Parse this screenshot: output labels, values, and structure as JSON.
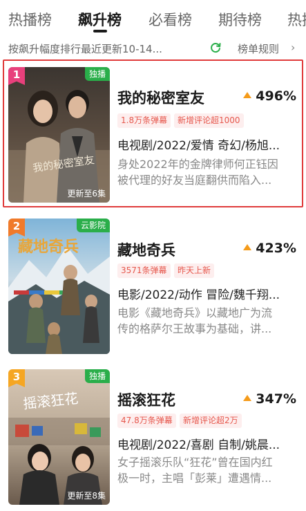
{
  "tabs": [
    {
      "label": "热播榜"
    },
    {
      "label": "飙升榜"
    },
    {
      "label": "必看榜"
    },
    {
      "label": "期待榜"
    },
    {
      "label": "热搜"
    }
  ],
  "subbar": {
    "desc": "按飙升幅度排行最近更新10-14...",
    "rules": "榜单规则",
    "chevron": "›"
  },
  "items": [
    {
      "rank": "1",
      "rank_color": "#e8407c",
      "badge": "独播",
      "episodes": "更新至6集",
      "title": "我的秘密室友",
      "growth": "496%",
      "tags": [
        "1.8万条弹幕",
        "新增评论超1000"
      ],
      "meta": "电视剧/2022/爱情 奇幻/杨旭...",
      "synopsis": [
        "身处2022年的金牌律师何正钰因",
        "被代理的好友当庭翻供而陷入..."
      ],
      "poster_art": "我的秘密室友"
    },
    {
      "rank": "2",
      "rank_color": "#f07a2a",
      "badge": "云影院",
      "episodes": "",
      "title": "藏地奇兵",
      "growth": "423%",
      "tags": [
        "3571条弹幕",
        "昨天上新"
      ],
      "meta": "电影/2022/动作 冒险/魏千翔...",
      "synopsis": [
        "电影《藏地奇兵》以藏地广为流",
        "传的格萨尔王故事为基础，讲..."
      ],
      "poster_art": "藏地奇兵"
    },
    {
      "rank": "3",
      "rank_color": "#f5a623",
      "badge": "独播",
      "episodes": "更新至8集",
      "title": "摇滚狂花",
      "growth": "347%",
      "tags": [
        "47.8万条弹幕",
        "新增评论超2万"
      ],
      "meta": "电视剧/2022/喜剧 自制/姚晨...",
      "synopsis": [
        "女子摇滚乐队“狂花”曾在国内红",
        "极一时，主唱「彭莱」遭遇情..."
      ],
      "poster_art": "摇滚狂花"
    }
  ],
  "colors": {
    "accent_green": "#2aae4a",
    "highlight_red": "#e03a3a",
    "growth_arrow": "#f59b1a",
    "tag_text": "#e6584d"
  }
}
